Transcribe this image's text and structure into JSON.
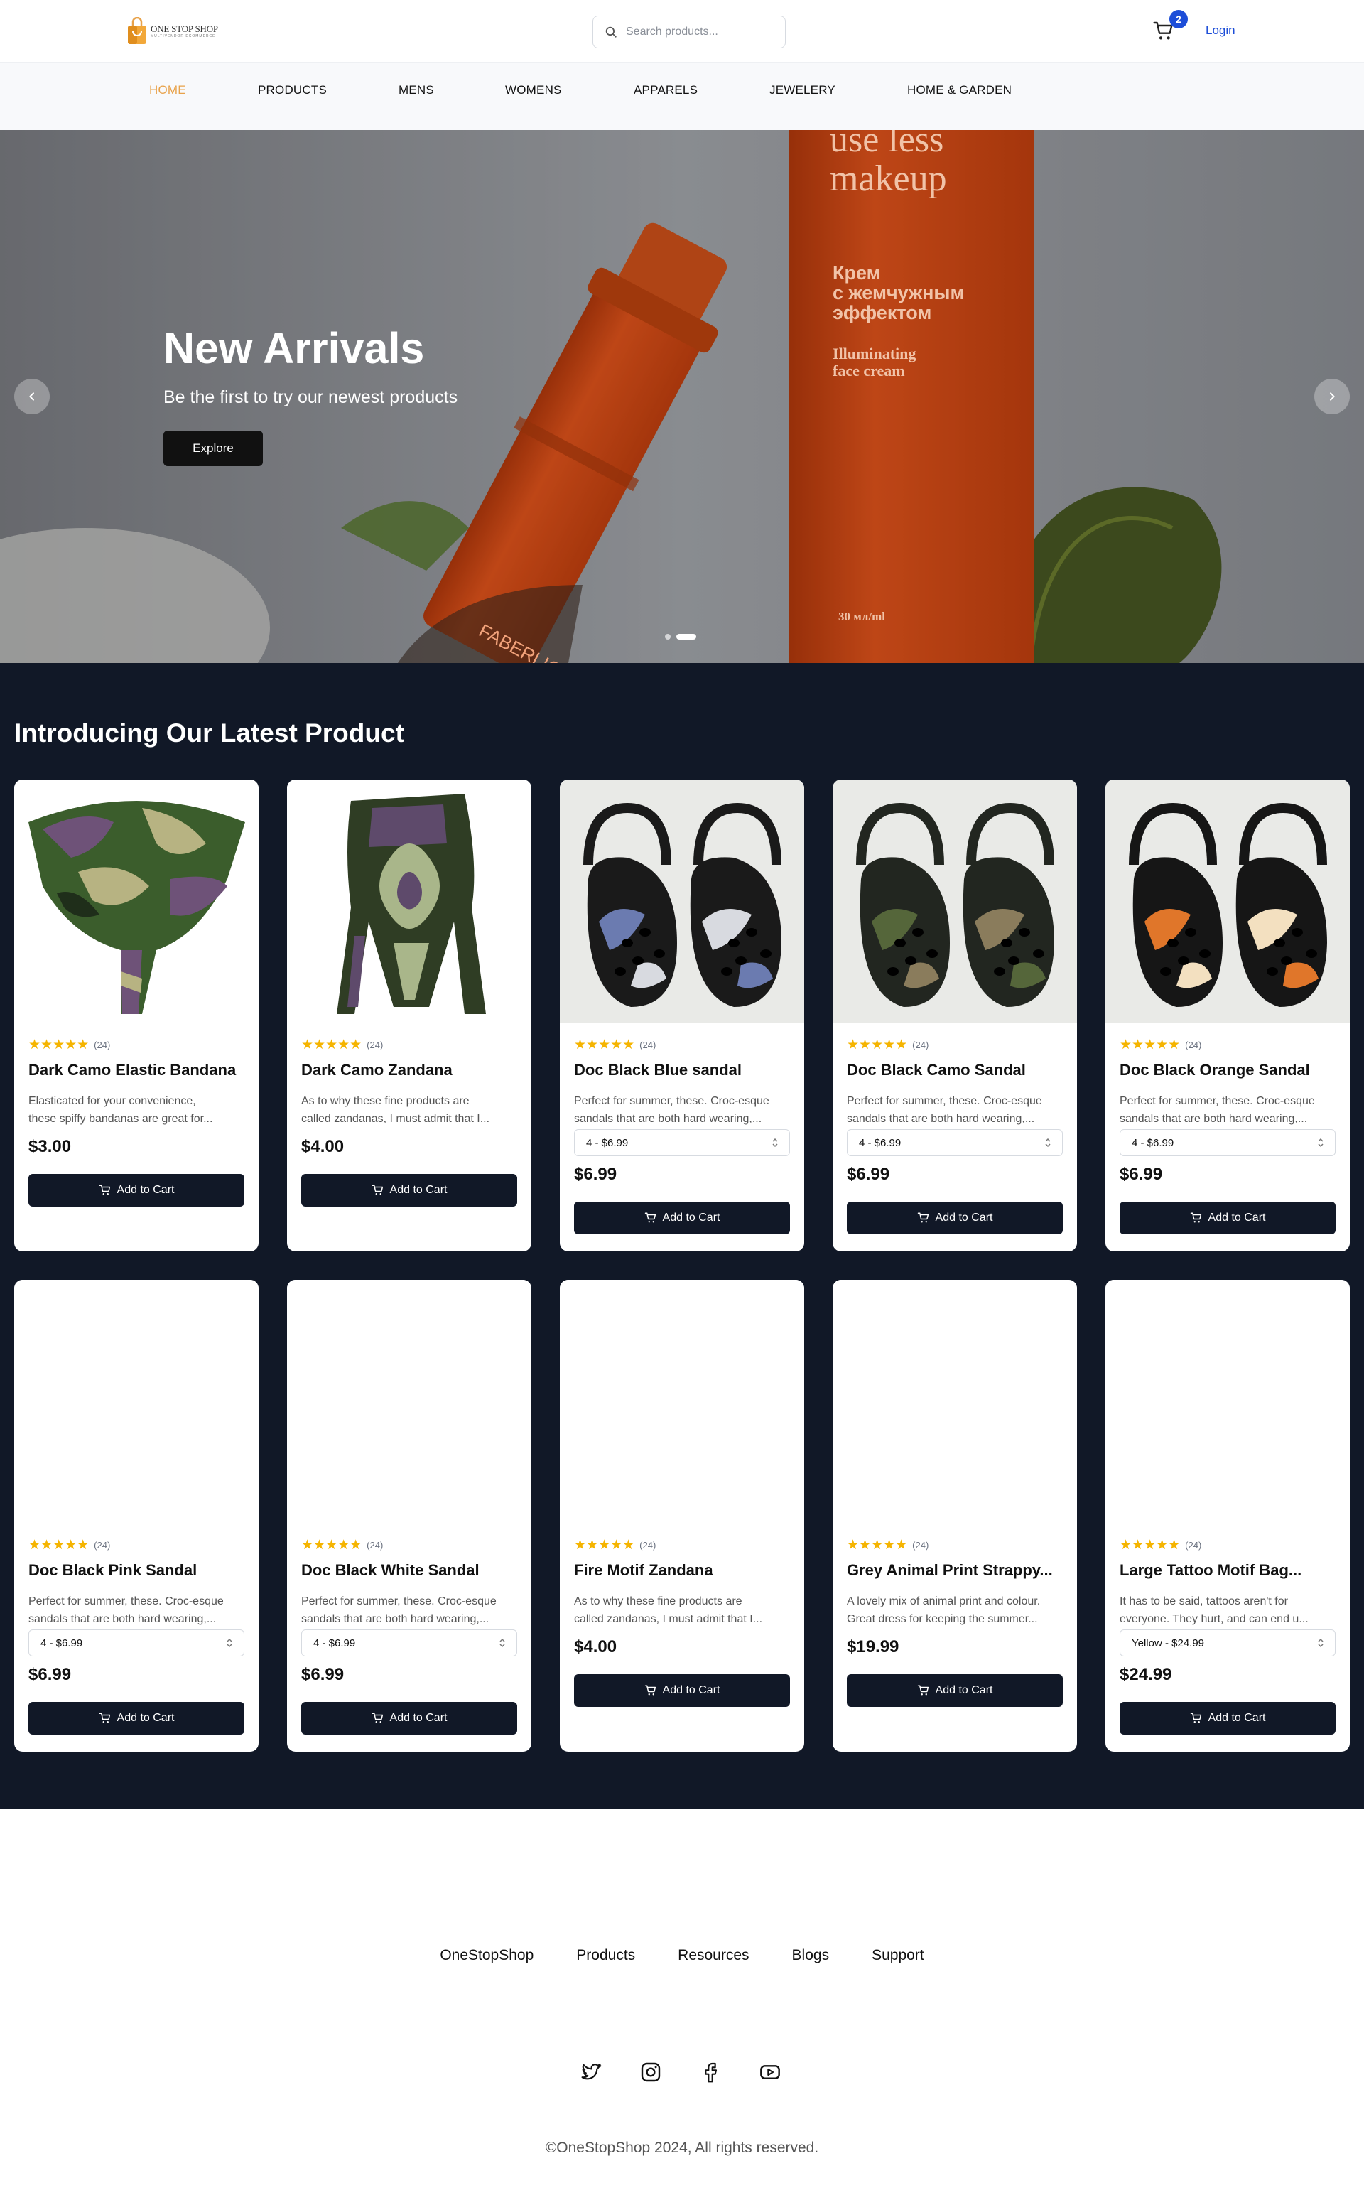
{
  "brand": {
    "name": "ONE STOP SHOP",
    "tagline": "MULTIVENDOR ECOMMERCE"
  },
  "search": {
    "placeholder": "Search products..."
  },
  "cart": {
    "count": "2"
  },
  "header": {
    "login": "Login"
  },
  "nav": [
    "HOME",
    "PRODUCTS",
    "MENS",
    "WOMENS",
    "APPARELS",
    "JEWELERY",
    "HOME & GARDEN"
  ],
  "hero": {
    "title": "New Arrivals",
    "subtitle": "Be the first to try our newest products",
    "button": "Explore",
    "slides": 2,
    "active_slide": 2,
    "image_text": [
      "use less",
      "makeup",
      "Крем",
      "с жемчужным",
      "эффектом",
      "Illuminating",
      "face cream",
      "30 мл/ml",
      "FABERLIC"
    ]
  },
  "latest": {
    "heading": "Introducing Our Latest Product"
  },
  "products": [
    {
      "name": "Dark Camo Elastic Bandana",
      "rating_count": "(24)",
      "desc1": "Elasticated for your convenience,",
      "desc2": "these spiffy bandanas are great for...",
      "variant": "",
      "price": "$3.00",
      "cta": "Add to Cart",
      "image": "bandana-camo"
    },
    {
      "name": "Dark Camo Zandana",
      "rating_count": "(24)",
      "desc1": "As to why these fine products are",
      "desc2": "called zandanas, I must admit that I...",
      "variant": "",
      "price": "$4.00",
      "cta": "Add to Cart",
      "image": "zandana-camo"
    },
    {
      "name": "Doc Black Blue sandal",
      "rating_count": "(24)",
      "desc1": "Perfect for summer, these. Croc-esque",
      "desc2": "sandals that are both hard wearing,...",
      "variant": "4 - $6.99",
      "price": "$6.99",
      "cta": "Add to Cart",
      "image": "sandal-blue"
    },
    {
      "name": "Doc Black Camo Sandal",
      "rating_count": "(24)",
      "desc1": "Perfect for summer, these. Croc-esque",
      "desc2": "sandals that are both hard wearing,...",
      "variant": "4 - $6.99",
      "price": "$6.99",
      "cta": "Add to Cart",
      "image": "sandal-camo"
    },
    {
      "name": "Doc Black Orange Sandal",
      "rating_count": "(24)",
      "desc1": "Perfect for summer, these. Croc-esque",
      "desc2": "sandals that are both hard wearing,...",
      "variant": "4 - $6.99",
      "price": "$6.99",
      "cta": "Add to Cart",
      "image": "sandal-orange"
    },
    {
      "name": "Doc Black Pink Sandal",
      "rating_count": "(24)",
      "desc1": "Perfect for summer, these. Croc-esque",
      "desc2": "sandals that are both hard wearing,...",
      "variant": "4 - $6.99",
      "price": "$6.99",
      "cta": "Add to Cart",
      "image": ""
    },
    {
      "name": "Doc Black White Sandal",
      "rating_count": "(24)",
      "desc1": "Perfect for summer, these. Croc-esque",
      "desc2": "sandals that are both hard wearing,...",
      "variant": "4 - $6.99",
      "price": "$6.99",
      "cta": "Add to Cart",
      "image": ""
    },
    {
      "name": "Fire Motif Zandana",
      "rating_count": "(24)",
      "desc1": "As to why these fine products are",
      "desc2": "called zandanas, I must admit that I...",
      "variant": "",
      "price": "$4.00",
      "cta": "Add to Cart",
      "image": ""
    },
    {
      "name": "Grey Animal Print Strappy...",
      "rating_count": "(24)",
      "desc1": "A lovely mix of animal print and colour.",
      "desc2": "Great dress for keeping the summer...",
      "variant": "",
      "price": "$19.99",
      "cta": "Add to Cart",
      "image": ""
    },
    {
      "name": "Large Tattoo Motif Bag...",
      "rating_count": "(24)",
      "desc1": "It has to be said, tattoos aren't for",
      "desc2": "everyone. They hurt, and can end u...",
      "variant": "Yellow - $24.99",
      "price": "$24.99",
      "cta": "Add to Cart",
      "image": ""
    }
  ],
  "footer": {
    "links": [
      "OneStopShop",
      "Products",
      "Resources",
      "Blogs",
      "Support"
    ],
    "social": [
      "twitter-icon",
      "instagram-icon",
      "facebook-icon",
      "youtube-icon"
    ],
    "copyright": "©OneStopShop 2024, All rights reserved."
  },
  "colors": {
    "accent": "#e8a24a",
    "link": "#1d4ed8",
    "dark": "#111827",
    "star": "#f5b400"
  }
}
